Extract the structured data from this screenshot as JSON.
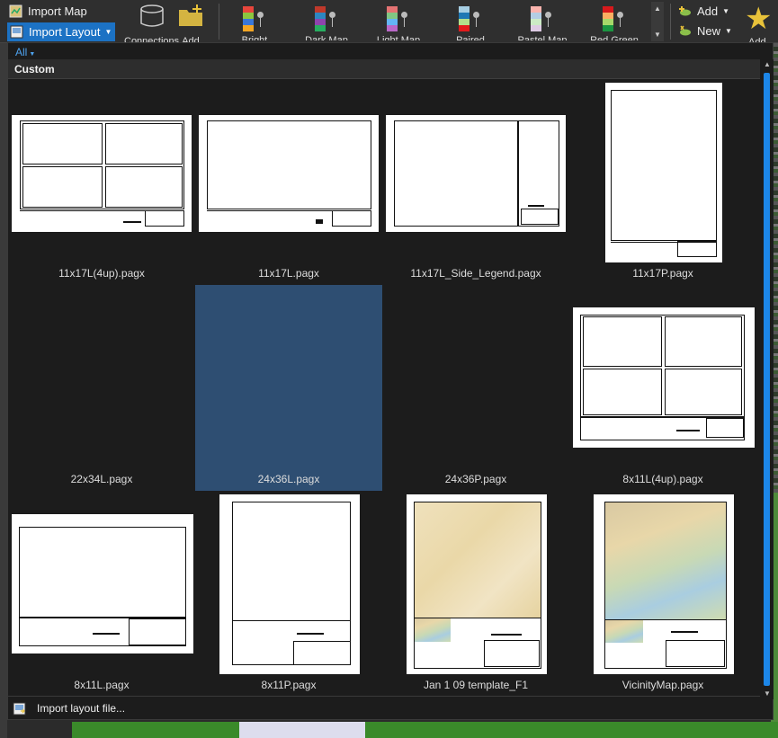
{
  "ribbon": {
    "import_map": "Import Map",
    "import_layout": "Import Layout",
    "connections": "Connections",
    "add_folder": "Add",
    "styles": [
      {
        "label": "Bright",
        "colors": [
          "#e8463c",
          "#8cc63f",
          "#3a77d8",
          "#f5a623"
        ]
      },
      {
        "label": "Dark Map",
        "colors": [
          "#c0392b",
          "#2e86c1",
          "#8e44ad",
          "#27ae60"
        ]
      },
      {
        "label": "Light Map",
        "colors": [
          "#e57373",
          "#81c784",
          "#64b5f6",
          "#ba68c8"
        ]
      },
      {
        "label": "Paired",
        "colors": [
          "#a6cee3",
          "#1f78b4",
          "#b2df8a",
          "#e31a1c"
        ]
      },
      {
        "label": "Pastel Map",
        "colors": [
          "#fbb4ae",
          "#b3cde3",
          "#ccebc5",
          "#decbe4"
        ]
      },
      {
        "label": "Red Green",
        "colors": [
          "#d7191c",
          "#fdae61",
          "#a6d96a",
          "#1a9641"
        ]
      }
    ],
    "add": "Add",
    "new": "New",
    "add_to_favorites": "Add"
  },
  "gallery": {
    "filter": "All",
    "section": "Custom",
    "items": [
      {
        "label": "11x17L(4up).pagx"
      },
      {
        "label": "11x17L.pagx"
      },
      {
        "label": "11x17L_Side_Legend.pagx"
      },
      {
        "label": "11x17P.pagx"
      },
      {
        "label": "22x34L.pagx"
      },
      {
        "label": "24x36L.pagx"
      },
      {
        "label": "24x36P.pagx"
      },
      {
        "label": "8x11L(4up).pagx"
      },
      {
        "label": "8x11L.pagx"
      },
      {
        "label": "8x11P.pagx"
      },
      {
        "label": "Jan 1 09 template_F1"
      },
      {
        "label": "VicinityMap.pagx"
      }
    ],
    "selected_index": 5,
    "footer": "Import layout file..."
  },
  "colors": {
    "accent": "#1c86e8",
    "selected": "#2e4e72",
    "panel": "#1c1c1c"
  }
}
